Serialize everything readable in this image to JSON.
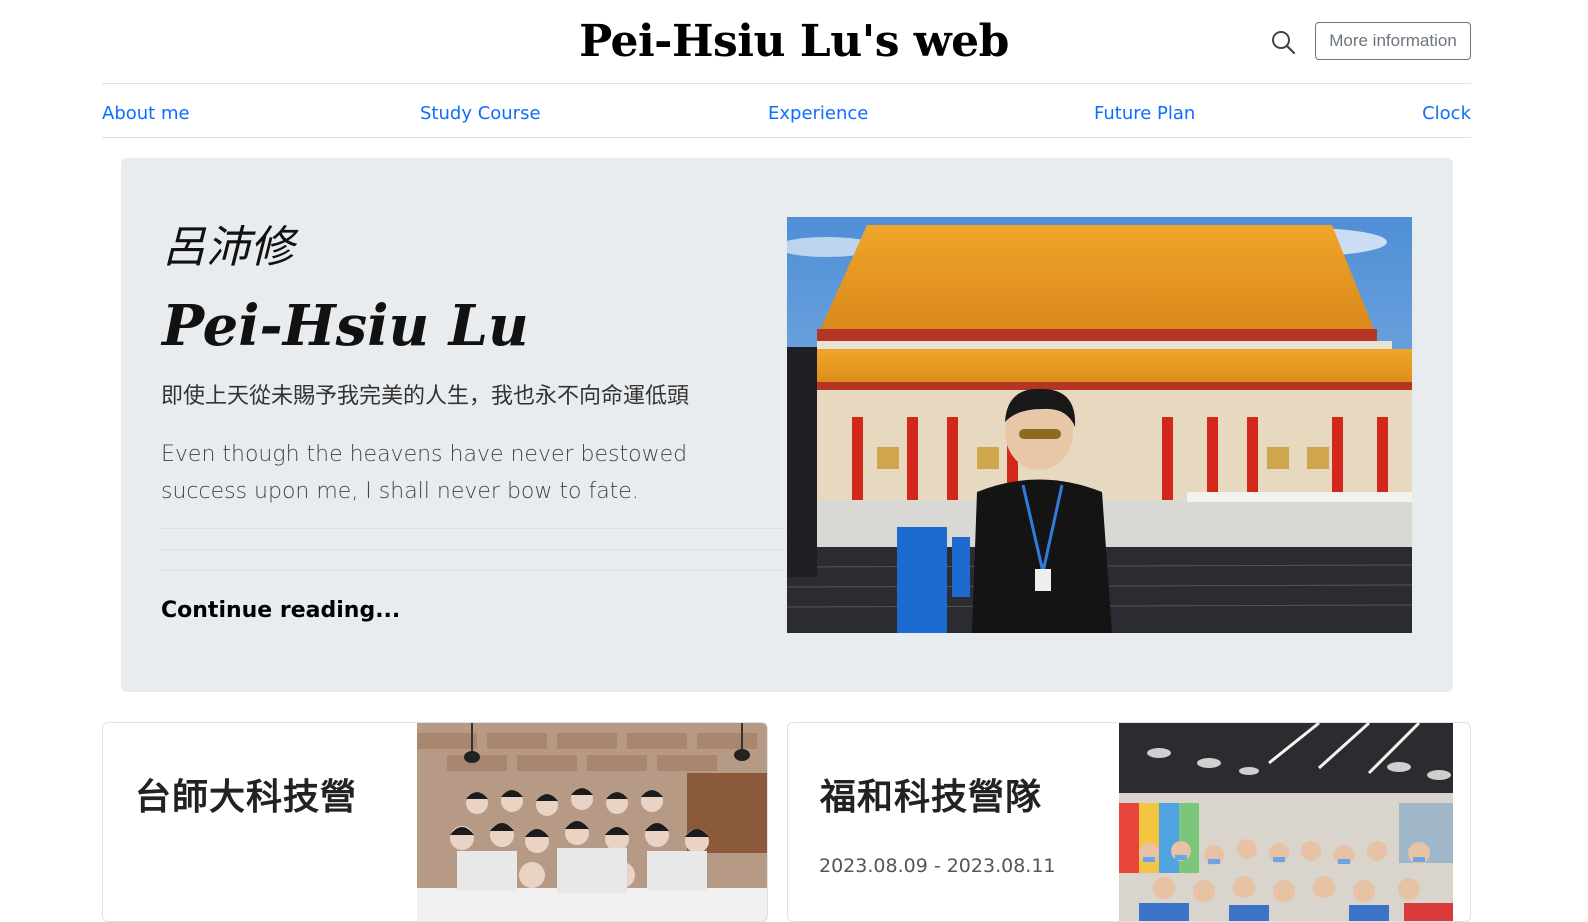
{
  "header": {
    "title": "Pei-Hsiu Lu's web",
    "more_button": "More information",
    "search_icon": "search-icon"
  },
  "nav": {
    "items": [
      {
        "label": "About me"
      },
      {
        "label": "Study Course"
      },
      {
        "label": "Experience"
      },
      {
        "label": "Future Plan"
      },
      {
        "label": "Clock"
      }
    ]
  },
  "hero": {
    "name_cn": "呂沛修",
    "name_en": "Pei-Hsiu Lu",
    "quote_cn": "即使上天從未賜予我完美的人生，我也永不向命運低頭",
    "quote_en": "Even though the heavens have never bestowed success upon me, I shall never bow to fate.",
    "link": "Continue reading...",
    "image": "photo of person in front of traditional Chinese hall with orange roof"
  },
  "cards": [
    {
      "title": "台師大科技營",
      "date": "",
      "image": "group photo of students"
    },
    {
      "title": "福和科技營隊",
      "date": "2023.08.09 - 2023.08.11",
      "image": "group photo of children in classroom"
    }
  ],
  "colors": {
    "link": "#0d6efd",
    "hero_bg": "#e9ecef",
    "button_border": "#6c757d"
  }
}
